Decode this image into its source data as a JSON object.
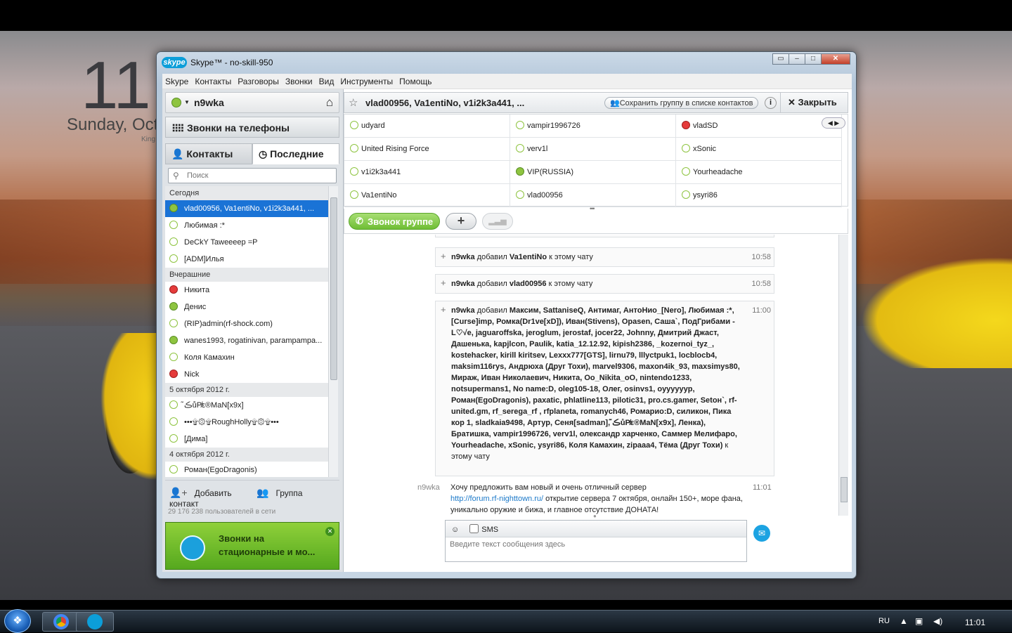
{
  "desktop": {
    "clock_hour": "11",
    "clock_date": "Sunday, Oct",
    "clock_location": "King"
  },
  "window": {
    "logo": "skype",
    "title": "Skype™ - no-skill-950",
    "controls": [
      "restore-mini",
      "minimize",
      "maximize",
      "close"
    ]
  },
  "menu": [
    "Skype",
    "Контакты",
    "Разговоры",
    "Звонки",
    "Вид",
    "Инструменты",
    "Помощь"
  ],
  "left": {
    "user_name": "n9wka",
    "call_phones": "Звонки на телефоны",
    "tab_contacts": "Контакты",
    "tab_recent": "Последние",
    "search_placeholder": "Поиск",
    "groups": [
      {
        "title": "Сегодня",
        "items": [
          {
            "name": "vlad00956, Va1entiNo, v1i2k3a441, ...",
            "status": "group",
            "selected": true
          },
          {
            "name": "Любимая :*",
            "status": "offline"
          },
          {
            "name": "DeCkY Taweeeep =P",
            "status": "offline"
          },
          {
            "name": "[ADM]Илья",
            "status": "offline"
          }
        ]
      },
      {
        "title": "Вчерашние",
        "items": [
          {
            "name": "Никита",
            "status": "busy"
          },
          {
            "name": "Денис",
            "status": "online"
          },
          {
            "name": "(RIP)admin(rf-shock.com)",
            "status": "offline"
          },
          {
            "name": "wanes1993, rogatinivan, parampampa...",
            "status": "group"
          },
          {
            "name": "Коля Камахин",
            "status": "offline"
          },
          {
            "name": "Nick",
            "status": "busy"
          }
        ]
      },
      {
        "title": "5 октября 2012 г.",
        "items": [
          {
            "name": "ڪ̃ůP̸ε®MaN[x9x]",
            "status": "offline"
          },
          {
            "name": "•••۩۞۩RoughHolly۩۞۩•••",
            "status": "offline"
          },
          {
            "name": "[Дима]",
            "status": "offline"
          }
        ]
      },
      {
        "title": "4 октября 2012 г.",
        "items": [
          {
            "name": "Роман(EgoDragonis)",
            "status": "offline"
          }
        ]
      }
    ],
    "add_contact": "Добавить контакт",
    "group": "Группа",
    "online_count": "29 176 238 пользователей в сети",
    "promo": "Звонки на стационарные и мо..."
  },
  "chat": {
    "title": "vlad00956, Va1entiNo, v1i2k3a441, ...",
    "save_group": "Сохранить группу в списке контактов",
    "info": "i",
    "close": "Закрыть",
    "participants": [
      {
        "name": "udyard",
        "status": "offline"
      },
      {
        "name": "vampir1996726",
        "status": "offline"
      },
      {
        "name": "vladSD",
        "status": "busy"
      },
      {
        "name": "United Rising Force",
        "status": "offline"
      },
      {
        "name": "verv1l",
        "status": "offline"
      },
      {
        "name": "xSonic",
        "status": "offline"
      },
      {
        "name": "v1i2k3a441",
        "status": "offline"
      },
      {
        "name": "VIP(RUSSIA)",
        "status": "online"
      },
      {
        "name": "Yourheadache",
        "status": "offline"
      },
      {
        "name": "Va1entiNo",
        "status": "offline"
      },
      {
        "name": "vlad00956",
        "status": "offline"
      },
      {
        "name": "ysyri86",
        "status": "offline"
      }
    ],
    "call_group": "Звонок группе",
    "events": [
      {
        "actor": "n9wka",
        "verb": "добавил",
        "target": "Va1entiNo",
        "suffix": "к этому чату",
        "time": "10:58"
      },
      {
        "actor": "n9wka",
        "verb": "добавил",
        "target": "vlad00956",
        "suffix": "к этому чату",
        "time": "10:58"
      },
      {
        "actor": "n9wka",
        "verb": "добавил",
        "target": "Максим, SattaniseQ, Антимаг, АнтоНио_[Nero], Любимая :*, [Curse]imp, Ромка(Dr1ve[xD]), Иван(Stivens), Opasen, Саша`, ПодГрибами - L♡√e, jaguaroffska, jeroglum, jerostaf, jocer22, Johnny, Дмитрий Джаст, Дашенька, kapjlcon, Paulik, katia_12.12.92, kipish2386, _kozernoi_tyz_, kostehacker, kirill kiritsev, Lexxx777[GTS], lirnu79, lllyctpuk1, locblocb4, maksim116rys, Андрюха (Друг Тохи), marvel9306, maxon4ik_93, maxsimys80, Мираж, Иван Николаевич, Никита, Oo_Nikita_oO, nintendo1233, notsupermans1, No name:D, oleg105-18, Олег, osinvs1, oyyyyyyp, Роман(EgoDragonis), paxatic, phlatline113, pilotic31, pro.cs.gamer, Setoн`, rf-united.gm, rf_serega_rf , rfplaneta, romanych46, Ромарио:D, силикон, Пика кор 1, sladkaia9498, Артур, Сеня[sadman], ڪ̃ůP̸ε®MaN[x9x], Ленка), Братишка, vampir1996726, verv1l, олександр харченко, Саммер Мелифаро, Yourheadache, xSonic, ysyri86, Коля Камахин, zipaaa4, Тёма (Друг Тохи)",
        "suffix": "к этому чату",
        "time": "11:00"
      }
    ],
    "message": {
      "author": "n9wka",
      "text_before": "Хочу предложить вам новый и очень отличный сервер",
      "link": "http://forum.rf-nighttown.ru/",
      "text_after": "открытие сервера 7 октября, онлайн 150+, море фана, уникально оружие и бижа, и главное отсутствие ДОНАТА!",
      "time": "11:01"
    },
    "sms_label": "SMS",
    "input_placeholder": "Введите текст сообщения здесь"
  },
  "taskbar": {
    "lang": "RU",
    "time": "11:01"
  },
  "colors": {
    "accent": "#1a73d6",
    "online": "#8ec440",
    "busy": "#e53b3b",
    "call_green": "#6fbe35",
    "skype_blue": "#0c9ed9"
  }
}
